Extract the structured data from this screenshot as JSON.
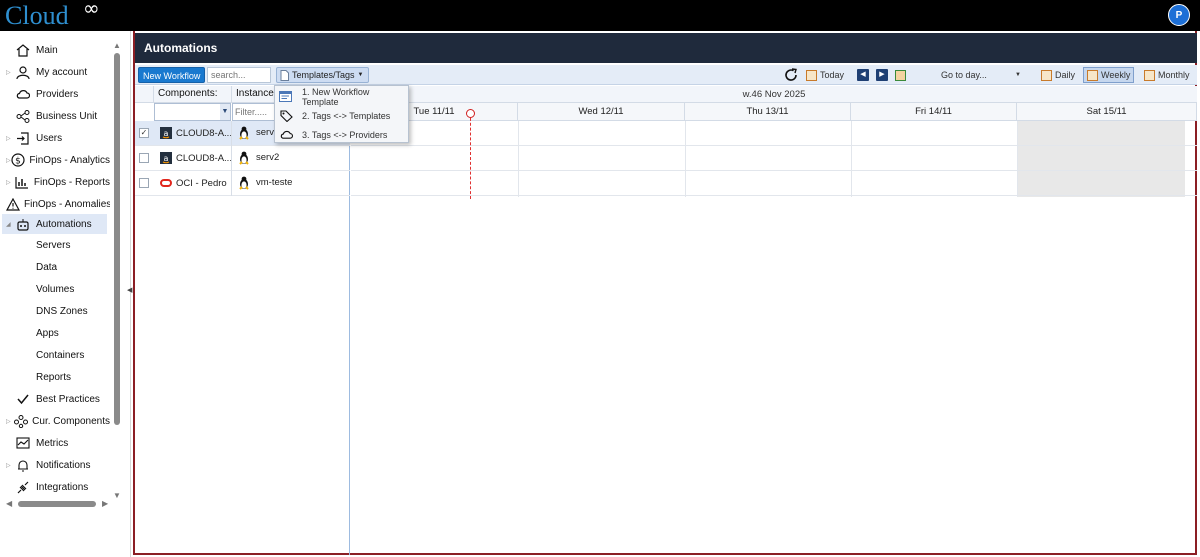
{
  "app": {
    "logo_text": "Cloud",
    "logo_symbol": "∞",
    "user_initial": "P"
  },
  "sidebar": {
    "items": [
      {
        "label": "Main",
        "icon": "home-icon"
      },
      {
        "label": "My account",
        "icon": "user-icon"
      },
      {
        "label": "Providers",
        "icon": "cloud-icon"
      },
      {
        "label": "Business Unit",
        "icon": "hierarchy-icon"
      },
      {
        "label": "Users",
        "icon": "login-icon"
      },
      {
        "label": "FinOps - Analytics",
        "icon": "dollar-icon"
      },
      {
        "label": "FinOps - Reports",
        "icon": "report-icon"
      },
      {
        "label": "FinOps - Anomalies",
        "icon": "warning-icon"
      },
      {
        "label": "Automations",
        "icon": "robot-icon"
      }
    ],
    "sub_items": [
      "Servers",
      "Data",
      "Volumes",
      "DNS Zones",
      "Apps",
      "Containers",
      "Reports"
    ],
    "bottom_items": [
      {
        "label": "Best Practices",
        "icon": "check-icon"
      },
      {
        "label": "Cur. Components",
        "icon": "components-icon"
      },
      {
        "label": "Metrics",
        "icon": "chart-icon"
      },
      {
        "label": "Notifications",
        "icon": "bell-icon"
      },
      {
        "label": "Integrations",
        "icon": "plug-icon"
      }
    ]
  },
  "main": {
    "title": "Automations",
    "toolbar": {
      "new_workflow": "New Workflow",
      "search_placeholder": "search...",
      "templates_tags": "Templates/Tags",
      "today": "Today",
      "go_to_day": "Go to day...",
      "daily": "Daily",
      "weekly": "Weekly",
      "monthly": "Monthly"
    },
    "grid": {
      "col_components": "Components:",
      "col_instances": "Instances",
      "filter_placeholder": "Filter.....",
      "rows": [
        {
          "component": "CLOUD8-A...",
          "instance": "serv1",
          "provider_icon": "aws-icon",
          "os_icon": "linux-icon",
          "checked": "✓"
        },
        {
          "component": "CLOUD8-A...",
          "instance": "serv2",
          "provider_icon": "aws-icon",
          "os_icon": "linux-icon",
          "checked": ""
        },
        {
          "component": "OCI - Pedro",
          "instance": "vm-teste",
          "provider_icon": "oracle-icon",
          "os_icon": "linux-icon",
          "checked": ""
        }
      ]
    },
    "calendar": {
      "week_label": "w.46 Nov 2025",
      "days": [
        "Tue 11/11",
        "Wed 12/11",
        "Thu 13/11",
        "Fri 14/11",
        "Sat 15/11"
      ]
    },
    "dropdown": {
      "items": [
        {
          "label": "1. New Workflow Template",
          "icon": "template-icon"
        },
        {
          "label": "2. Tags <-> Templates",
          "icon": "tag-icon"
        },
        {
          "label": "3. Tags <-> Providers",
          "icon": "cloud-icon"
        }
      ]
    }
  },
  "colors": {
    "header_bg": "#1f2a3c",
    "accent": "#1979cf",
    "frame": "#8b1e24",
    "today_marker": "#d02020"
  }
}
